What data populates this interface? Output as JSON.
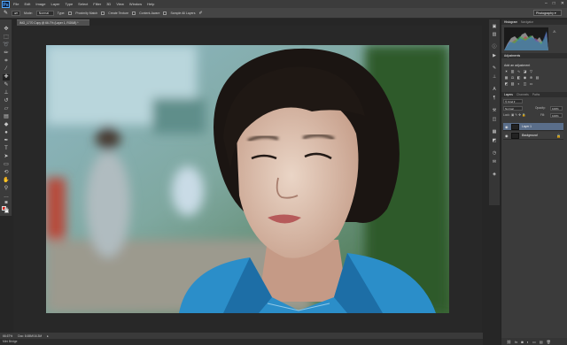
{
  "app": {
    "logo": "Ps"
  },
  "menu": [
    "File",
    "Edit",
    "Image",
    "Layer",
    "Type",
    "Select",
    "Filter",
    "3D",
    "View",
    "Window",
    "Help"
  ],
  "window_controls": [
    "–",
    "□",
    "✕"
  ],
  "options": {
    "mode_label": "Mode:",
    "mode_value": "Normal",
    "type_label": "Type:",
    "proximity": "Proximity Match",
    "create_texture": "Create Texture",
    "content_aware": "Content-Aware",
    "sample_all": "Sample All Layers"
  },
  "workspace": "Photography",
  "document_tab": "IMG_1770 Copy @ 66.7% (Layer 1, RGB/8) *",
  "status": {
    "zoom": "66.67%",
    "doc": "Doc: 8.65M/16.3M"
  },
  "bottom_bar": "Mini Bridge",
  "panels": {
    "histogram_tabs": [
      "Histogram",
      "Navigator"
    ],
    "adjustments_tabs": [
      "Adjustments"
    ],
    "adjustments_title": "Add an adjustment",
    "layers_tabs": [
      "Layers",
      "Channels",
      "Paths"
    ],
    "blend_mode": "Normal",
    "opacity_label": "Opacity:",
    "opacity_value": "100%",
    "lock_label": "Lock:",
    "fill_label": "Fill:",
    "fill_value": "100%",
    "layers": [
      {
        "name": "Layer 1",
        "selected": true
      },
      {
        "name": "Background",
        "selected": false
      }
    ]
  },
  "colors": {
    "foreground": "#d8281f",
    "background": "#ffffff",
    "accent": "#5a6e8a"
  }
}
